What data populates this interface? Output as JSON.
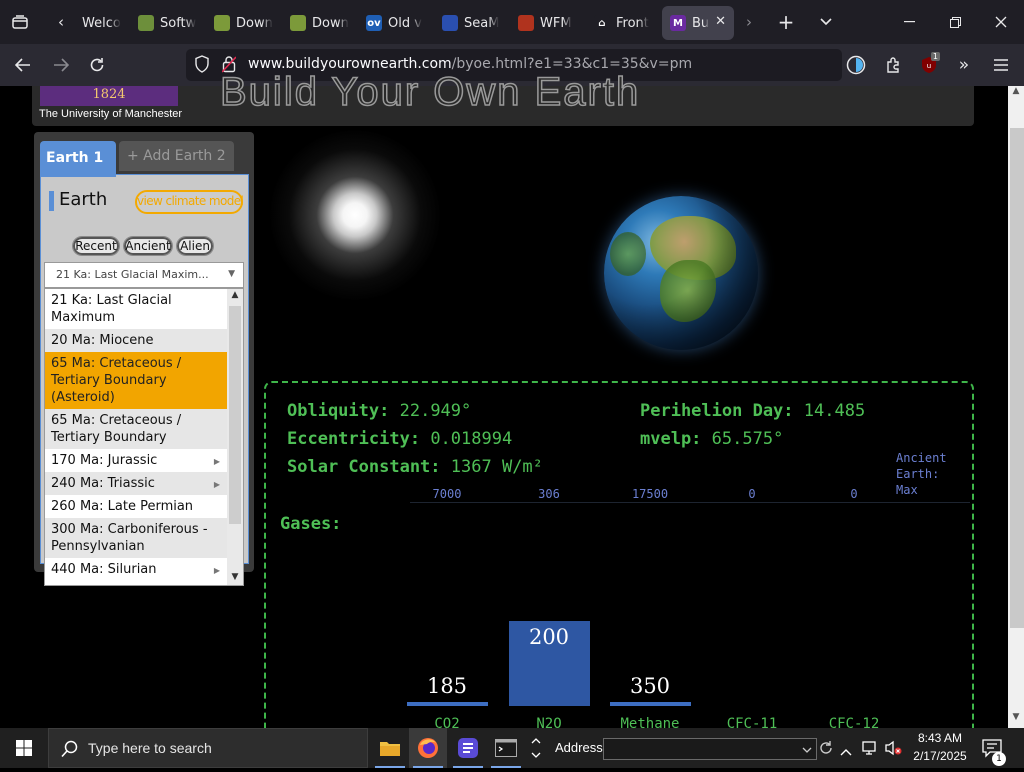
{
  "browser": {
    "tabs": [
      {
        "title": "Welco",
        "favicon": "welcome-icon"
      },
      {
        "title": "Softw",
        "favicon": "software-icon"
      },
      {
        "title": "Down",
        "favicon": "download-icon"
      },
      {
        "title": "Down",
        "favicon": "download-icon"
      },
      {
        "title": "Old v",
        "favicon": "ov-icon",
        "fav_text": "ov"
      },
      {
        "title": "SeaM",
        "favicon": "seam-icon"
      },
      {
        "title": "WFM",
        "favicon": "wfm-icon"
      },
      {
        "title": "Front",
        "favicon": "building-icon"
      },
      {
        "title": "Bu",
        "favicon": "m-icon",
        "fav_text": "M",
        "active": true
      }
    ],
    "url_host": "www.buildyourownearth.com",
    "url_path": "/byoe.html?e1=33&c1=35&v=pm",
    "extension_badge": "1"
  },
  "header": {
    "logo_year": "1824",
    "university": "The University of Manchester",
    "site_title": "Build Your Own Earth"
  },
  "panel": {
    "earth_tab": "Earth 1",
    "add_tab": "+ Add Earth 2",
    "earth_label": "Earth",
    "climate_button": "view climate model",
    "period_buttons": [
      "Recent",
      "Ancient",
      "Alien"
    ],
    "selected_preset": "21 Ka: Last Glacial Maxim...",
    "dropdown_items": [
      {
        "label": "21 Ka: Last Glacial Maximum",
        "lines": [
          "21 Ka: Last Glacial",
          "Maximum"
        ]
      },
      {
        "label": "20 Ma: Miocene",
        "lines": [
          "20 Ma: Miocene"
        ]
      },
      {
        "label": "65 Ma: Cretaceous / Tertiary Boundary (Asteroid)",
        "lines": [
          "65 Ma: Cretaceous /",
          "Tertiary Boundary",
          "(Asteroid)"
        ]
      },
      {
        "label": "65 Ma: Cretaceous / Tertiary Boundary",
        "lines": [
          "65 Ma: Cretaceous /",
          "Tertiary Boundary"
        ]
      },
      {
        "label": "170 Ma: Jurassic",
        "lines": [
          "170 Ma: Jurassic"
        ],
        "has_submenu": true
      },
      {
        "label": "240 Ma: Triassic",
        "lines": [
          "240 Ma: Triassic"
        ],
        "has_submenu": true
      },
      {
        "label": "260 Ma: Late Permian",
        "lines": [
          "260 Ma: Late Permian"
        ]
      },
      {
        "label": "300 Ma: Carboniferous - Pennsylvanian",
        "lines": [
          "300 Ma: Carboniferous -",
          "Pennsylvanian"
        ]
      },
      {
        "label": "440 Ma: Silurian",
        "lines": [
          "440 Ma: Silurian"
        ],
        "has_submenu": true
      }
    ]
  },
  "params": {
    "obliquity_label": "Obliquity:",
    "obliquity_value": "22.949°",
    "eccentricity_label": "Eccentricity:",
    "eccentricity_value": "0.018994",
    "solar_label": "Solar Constant:",
    "solar_value": "1367 W/m²",
    "perihelion_label": "Perihelion Day:",
    "perihelion_value": "14.485",
    "mvelp_label": "mvelp:",
    "mvelp_value": "65.575°",
    "ancient_max_lines": [
      "Ancient",
      "Earth:",
      "Max"
    ],
    "gases_label": "Gases:"
  },
  "gases": [
    {
      "name": "CO2",
      "value": 185,
      "value_label": "185",
      "max_label": "7000",
      "max": 7000
    },
    {
      "name": "N2O",
      "value": 200,
      "value_label": "200",
      "max_label": "306",
      "max": 306
    },
    {
      "name": "Methane",
      "value": 350,
      "value_label": "350",
      "max_label": "17500",
      "max": 17500
    },
    {
      "name": "CFC-11",
      "value": 0,
      "value_label": "",
      "max_label": "0",
      "max": 0
    },
    {
      "name": "CFC-12",
      "value": 0,
      "value_label": "",
      "max_label": "0",
      "max": 0
    }
  ],
  "taskbar": {
    "search_placeholder": "Type here to search",
    "address_label": "Address",
    "time": "8:43 AM",
    "date": "2/17/2025",
    "notification_count": "1"
  },
  "colors": {
    "accent_green": "#4fbf56",
    "selected_orange": "#f2a500",
    "bar_blue": "#2e57a3",
    "tab_blue": "#5a8fd6"
  }
}
